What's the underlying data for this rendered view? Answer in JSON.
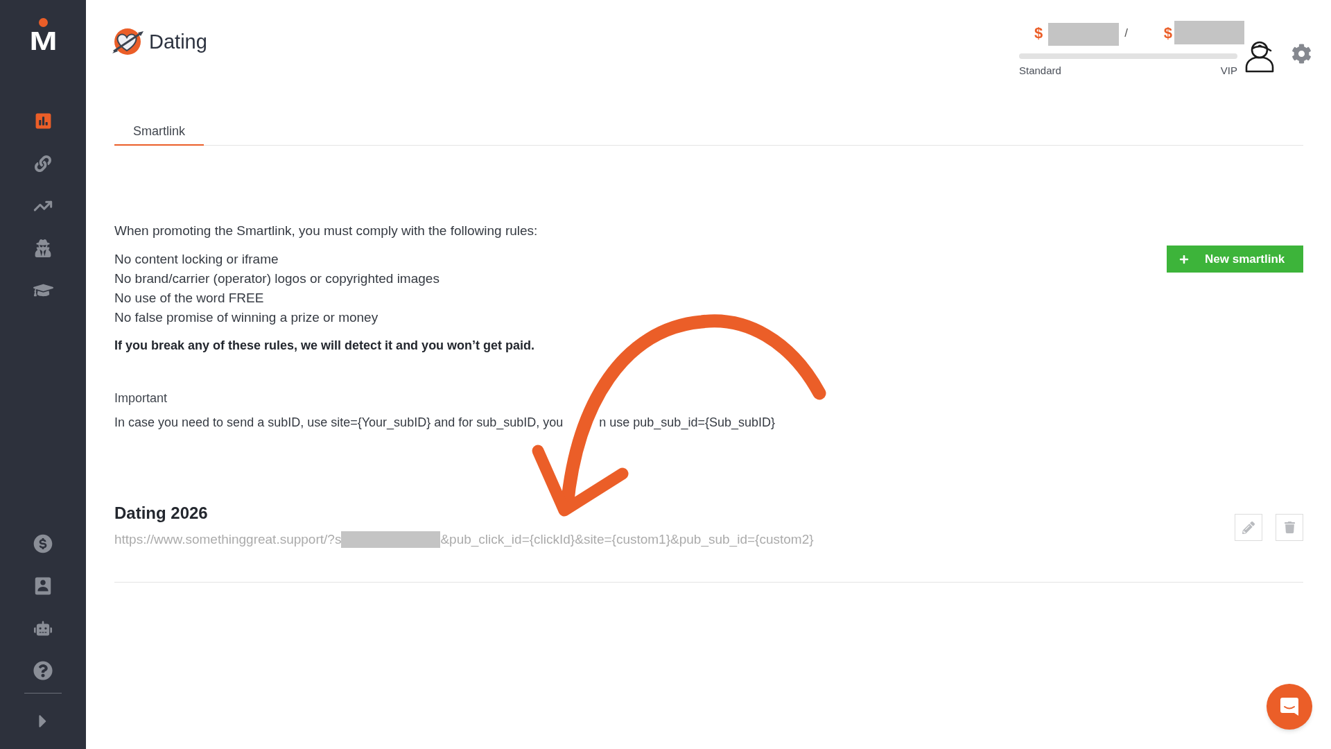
{
  "sidebar": {
    "logo": "M",
    "items": [
      {
        "selected": true
      },
      {
        "selected": false
      },
      {
        "selected": false
      },
      {
        "selected": false
      },
      {
        "selected": false
      }
    ],
    "bottom_items": [
      {
        "selected": false
      },
      {
        "selected": false
      },
      {
        "selected": false
      },
      {
        "selected": false
      }
    ]
  },
  "header": {
    "title": "Dating",
    "balance": {
      "currency_symbols": [
        "$",
        "$"
      ],
      "separator": "/",
      "level": 0,
      "tier_labels": [
        "Standard",
        "VIP"
      ]
    }
  },
  "tabs": [
    {
      "label": "Smartlink",
      "selected": true
    }
  ],
  "rules": {
    "intro": "When promoting the Smartlink, you must comply with the following rules:",
    "items": [
      "No content locking or iframe",
      "No brand/carrier (operator) logos or copyrighted images",
      "No use of the word FREE",
      "No false promise of winning a prize or money"
    ],
    "warning": "If you break any of these rules, we will detect it and you won’t get paid."
  },
  "new_button": {
    "label": "New smartlink"
  },
  "important": {
    "title": "Important",
    "text_parts": [
      "In case you need to send a subID, use site={Your_subID} and for sub_subID, you",
      "n use pub_sub_id={Sub_subID}"
    ]
  },
  "smartlinks": [
    {
      "name": "Dating 2026",
      "url_parts": [
        "https://www.somethinggreat.support/?s",
        "&pub_click_id={clickId}&site={custom1}&pub_sub_id={custom2}"
      ]
    }
  ]
}
